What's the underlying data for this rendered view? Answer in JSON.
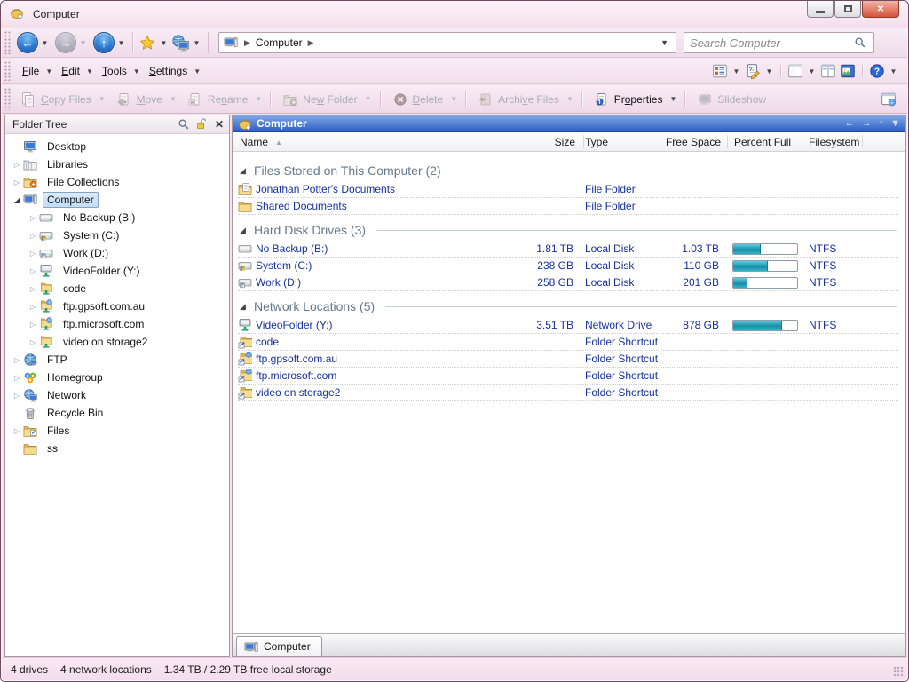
{
  "colors": {
    "chrome_tint": "#f6e3ee",
    "pane_header_blue_top": "#7fa8e6",
    "pane_header_blue_bottom": "#2d5fc6",
    "item_text_navy": "#16309c",
    "group_header_text": "#64788c",
    "percent_bar_teal": "#1b8da6",
    "tree_selection_blue": "#c2dcf5",
    "close_button_red": "#d4543c"
  },
  "window": {
    "title": "Computer",
    "controls": {
      "minimize": "minimize-button",
      "maximize": "maximize-button",
      "close": "close-button"
    }
  },
  "nav": {
    "buttons": [
      {
        "name": "back",
        "icon": "arrow-left",
        "enabled": true,
        "dropdown": true
      },
      {
        "name": "forward",
        "icon": "arrow-right",
        "enabled": false,
        "dropdown": true
      },
      {
        "name": "up",
        "icon": "arrow-up",
        "enabled": true,
        "dropdown": true
      }
    ],
    "favorites_icon": "star-icon",
    "location_icon": "globe-computer-icon",
    "breadcrumb": {
      "icon": "computer-icon",
      "segments": [
        "Computer"
      ]
    },
    "search": {
      "placeholder": "Search Computer",
      "icon": "search-icon"
    }
  },
  "menubar": {
    "items": [
      {
        "label": "File",
        "accel": 0
      },
      {
        "label": "Edit",
        "accel": 0
      },
      {
        "label": "Tools",
        "accel": 0
      },
      {
        "label": "Settings",
        "accel": 0
      }
    ],
    "right_buttons": [
      {
        "icon": "view-mode-icon",
        "dropdown": true
      },
      {
        "icon": "inline-edit-icon",
        "dropdown": true
      },
      {
        "icon": "panel-layout-icon",
        "dropdown": true,
        "sep_before": true
      },
      {
        "icon": "dual-pane-icon",
        "dropdown": false
      },
      {
        "icon": "viewer-pane-icon",
        "dropdown": false
      },
      {
        "icon": "help-icon",
        "dropdown": true,
        "sep_before": true
      }
    ]
  },
  "toolbar": {
    "buttons": [
      {
        "label": "Copy Files",
        "accel": 0,
        "icon": "copy-files-icon",
        "enabled": false,
        "dropdown": true
      },
      {
        "label": "Move",
        "accel": 0,
        "icon": "move-icon",
        "enabled": false,
        "dropdown": true
      },
      {
        "label": "Rename",
        "accel": 2,
        "icon": "rename-icon",
        "enabled": false,
        "dropdown": true
      },
      {
        "label": "New Folder",
        "accel": 2,
        "icon": "new-folder-icon",
        "enabled": false,
        "dropdown": true,
        "sep_before": true
      },
      {
        "label": "Delete",
        "accel": 0,
        "icon": "delete-icon",
        "enabled": false,
        "dropdown": true,
        "sep_before": true
      },
      {
        "label": "Archive Files",
        "accel": 5,
        "icon": "archive-icon",
        "enabled": false,
        "dropdown": true,
        "sep_before": true
      },
      {
        "label": "Properties",
        "accel": 2,
        "icon": "properties-icon",
        "enabled": true,
        "dropdown": true,
        "sep_before": true
      },
      {
        "label": "Slideshow",
        "accel": null,
        "icon": "slideshow-icon",
        "enabled": false,
        "dropdown": false,
        "sep_before": true
      }
    ],
    "right_button_icon": "customize-icon"
  },
  "tree": {
    "header": {
      "label": "Folder Tree",
      "icons": [
        "search-icon",
        "unlock-icon",
        "close-icon"
      ]
    },
    "items": [
      {
        "label": "Desktop",
        "indent": 0,
        "expander": "none",
        "icon": "desktop-icon",
        "selected": false
      },
      {
        "label": "Libraries",
        "indent": 0,
        "expander": "collapsed",
        "icon": "libraries-icon",
        "selected": false
      },
      {
        "label": "File Collections",
        "indent": 0,
        "expander": "collapsed",
        "icon": "collections-icon",
        "selected": false
      },
      {
        "label": "Computer",
        "indent": 0,
        "expander": "expanded",
        "icon": "computer-icon",
        "selected": true
      },
      {
        "label": "No Backup (B:)",
        "indent": 1,
        "expander": "collapsed",
        "icon": "drive-icon",
        "selected": false
      },
      {
        "label": "System (C:)",
        "indent": 1,
        "expander": "collapsed",
        "icon": "system-drive-icon",
        "selected": false
      },
      {
        "label": "Work (D:)",
        "indent": 1,
        "expander": "collapsed",
        "icon": "work-drive-icon",
        "selected": false
      },
      {
        "label": "VideoFolder (Y:)",
        "indent": 1,
        "expander": "collapsed",
        "icon": "network-drive-icon",
        "selected": false
      },
      {
        "label": "code",
        "indent": 1,
        "expander": "collapsed",
        "icon": "network-folder-icon",
        "selected": false
      },
      {
        "label": "ftp.gpsoft.com.au",
        "indent": 1,
        "expander": "collapsed",
        "icon": "ftp-site-icon",
        "selected": false
      },
      {
        "label": "ftp.microsoft.com",
        "indent": 1,
        "expander": "collapsed",
        "icon": "ftp-site-icon",
        "selected": false
      },
      {
        "label": "video on storage2",
        "indent": 1,
        "expander": "collapsed",
        "icon": "network-folder-icon",
        "selected": false
      },
      {
        "label": "FTP",
        "indent": 0,
        "expander": "collapsed",
        "icon": "ftp-globe-icon",
        "selected": false
      },
      {
        "label": "Homegroup",
        "indent": 0,
        "expander": "collapsed",
        "icon": "homegroup-icon",
        "selected": false
      },
      {
        "label": "Network",
        "indent": 0,
        "expander": "collapsed",
        "icon": "network-icon",
        "selected": false
      },
      {
        "label": "Recycle Bin",
        "indent": 0,
        "expander": "none",
        "icon": "recycle-bin-icon",
        "selected": false
      },
      {
        "label": "Files",
        "indent": 0,
        "expander": "collapsed",
        "icon": "files-shortcut-icon",
        "selected": false
      },
      {
        "label": "ss",
        "indent": 0,
        "expander": "none",
        "icon": "folder-icon",
        "selected": false
      }
    ]
  },
  "filepane": {
    "header": {
      "icon": "opus-icon",
      "label": "Computer",
      "buttons": [
        "nav-left-icon",
        "nav-right-icon",
        "nav-up-icon",
        "menu-down-icon"
      ]
    },
    "columns": {
      "name": "Name",
      "size": "Size",
      "type": "Type",
      "free": "Free Space",
      "pct": "Percent Full",
      "fs": "Filesystem"
    },
    "sorted_column": "name",
    "groups": [
      {
        "label": "Files Stored on This Computer (2)",
        "rows": [
          {
            "icon": "documents-folder-icon",
            "name": "Jonathan Potter's Documents",
            "size": "",
            "type": "File Folder",
            "free": "",
            "percent": null,
            "fs": ""
          },
          {
            "icon": "folder-icon",
            "name": "Shared Documents",
            "size": "",
            "type": "File Folder",
            "free": "",
            "percent": null,
            "fs": ""
          }
        ]
      },
      {
        "label": "Hard Disk Drives (3)",
        "rows": [
          {
            "icon": "drive-icon",
            "name": "No Backup (B:)",
            "size": "1.81 TB",
            "type": "Local Disk",
            "free": "1.03 TB",
            "percent": 43,
            "fs": "NTFS"
          },
          {
            "icon": "system-drive-icon",
            "name": "System (C:)",
            "size": "238 GB",
            "type": "Local Disk",
            "free": "110 GB",
            "percent": 54,
            "fs": "NTFS"
          },
          {
            "icon": "work-drive-icon",
            "name": "Work (D:)",
            "size": "258 GB",
            "type": "Local Disk",
            "free": "201 GB",
            "percent": 22,
            "fs": "NTFS"
          }
        ]
      },
      {
        "label": "Network Locations (5)",
        "rows": [
          {
            "icon": "network-drive-icon",
            "name": "VideoFolder (Y:)",
            "size": "3.51 TB",
            "type": "Network Drive",
            "free": "878 GB",
            "percent": 76,
            "fs": "NTFS"
          },
          {
            "icon": "folder-shortcut-icon",
            "name": "code",
            "size": "",
            "type": "Folder Shortcut",
            "free": "",
            "percent": null,
            "fs": ""
          },
          {
            "icon": "ftp-shortcut-icon",
            "name": "ftp.gpsoft.com.au",
            "size": "",
            "type": "Folder Shortcut",
            "free": "",
            "percent": null,
            "fs": ""
          },
          {
            "icon": "ftp-shortcut-icon",
            "name": "ftp.microsoft.com",
            "size": "",
            "type": "Folder Shortcut",
            "free": "",
            "percent": null,
            "fs": ""
          },
          {
            "icon": "folder-shortcut-icon",
            "name": "video on storage2",
            "size": "",
            "type": "Folder Shortcut",
            "free": "",
            "percent": null,
            "fs": ""
          }
        ]
      }
    ],
    "tab": {
      "icon": "computer-icon",
      "label": "Computer"
    }
  },
  "statusbar": {
    "segments": [
      "4 drives",
      "4 network locations",
      "1.34 TB / 2.29 TB free local storage"
    ]
  }
}
